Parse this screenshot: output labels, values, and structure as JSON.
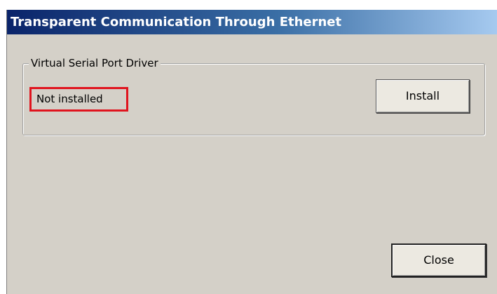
{
  "window": {
    "title": "Transparent Communication Through Ethernet"
  },
  "group": {
    "label": "Virtual Serial Port Driver",
    "status": "Not installed",
    "install_label": "Install"
  },
  "footer": {
    "close_label": "Close"
  },
  "colors": {
    "title_gradient_start": "#0a246a",
    "title_gradient_end": "#a6caf0",
    "dialog_background": "#d4d0c8",
    "status_highlight_border": "#e0141e"
  }
}
